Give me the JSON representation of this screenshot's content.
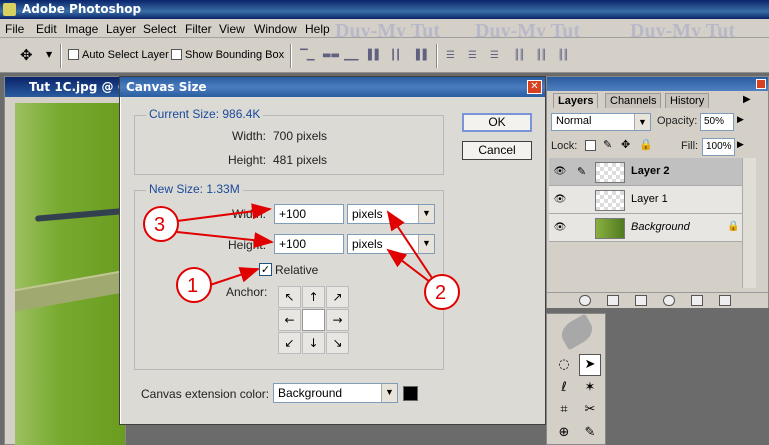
{
  "app": {
    "title": "Adobe Photoshop"
  },
  "menubar": {
    "items": [
      "File",
      "Edit",
      "Image",
      "Layer",
      "Select",
      "Filter",
      "View",
      "Window",
      "Help"
    ],
    "watermark": "Duy-My Tut"
  },
  "options": {
    "auto_select_layer": "Auto Select Layer",
    "show_bounding_box": "Show Bounding Box"
  },
  "document": {
    "title": "Tut 1C.jpg @ 66"
  },
  "dialog": {
    "title": "Canvas Size",
    "current_size_label": "Current Size: 986.4K",
    "current_width_label": "Width:",
    "current_width_value": "700 pixels",
    "current_height_label": "Height:",
    "current_height_value": "481 pixels",
    "new_size_label": "New Size: 1.33M",
    "width_label": "Width:",
    "width_value": "+100",
    "width_unit": "pixels",
    "height_label": "Height:",
    "height_value": "+100",
    "height_unit": "pixels",
    "relative_label": "Relative",
    "relative_checked": true,
    "anchor_label": "Anchor:",
    "extension_color_label": "Canvas extension color:",
    "extension_color_value": "Background",
    "extension_swatch_color": "#000000",
    "ok_label": "OK",
    "cancel_label": "Cancel"
  },
  "layers_palette": {
    "tabs": [
      "Layers",
      "Channels",
      "History"
    ],
    "blend_mode": "Normal",
    "opacity_label": "Opacity:",
    "opacity_value": "50%",
    "lock_label": "Lock:",
    "fill_label": "Fill:",
    "fill_value": "100%",
    "layers": [
      {
        "name": "Layer 2",
        "selected": true
      },
      {
        "name": "Layer 1",
        "selected": false
      },
      {
        "name": "Background",
        "selected": false,
        "locked": true
      }
    ]
  },
  "annotations": {
    "color": "#e00000",
    "callouts": [
      "1",
      "2",
      "3"
    ]
  }
}
